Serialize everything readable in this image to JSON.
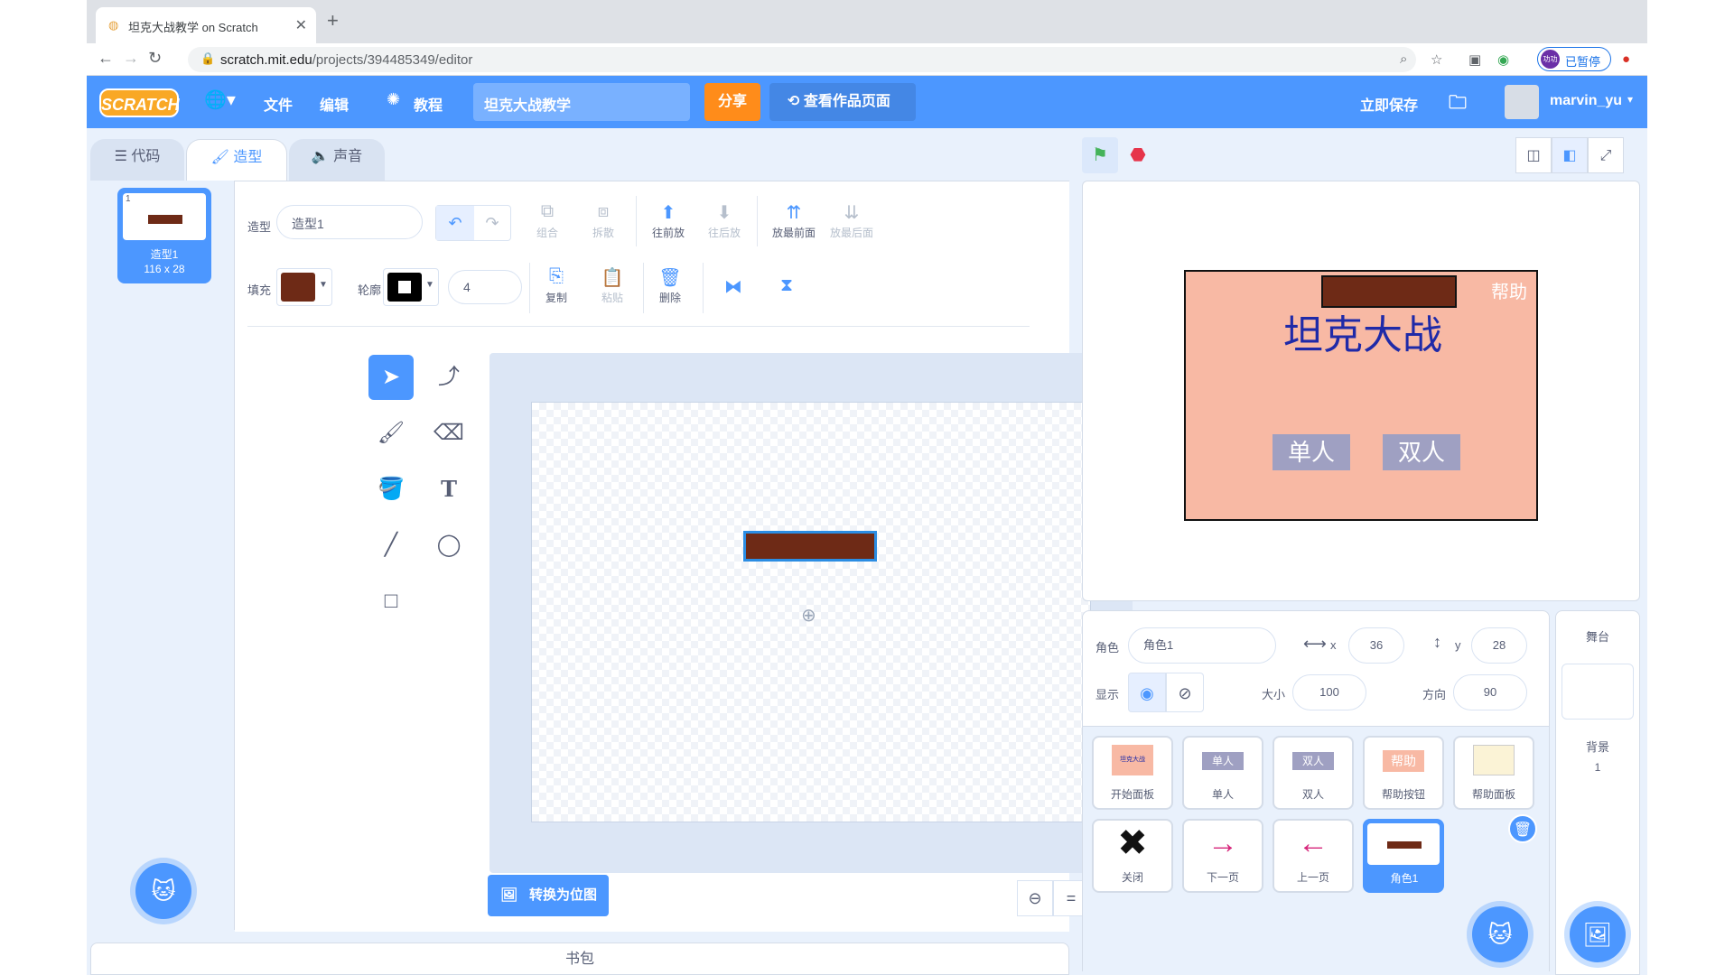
{
  "browser": {
    "tab_title": "坦克大战教学 on Scratch",
    "url_host": "scratch.mit.edu",
    "url_path": "/projects/394485349/editor",
    "profile_status": "已暂停",
    "profile_avatar_text": "功功"
  },
  "menu": {
    "logo": "SCRATCH",
    "file": "文件",
    "edit": "编辑",
    "tutorials": "教程",
    "project_title": "坦克大战教学",
    "share": "分享",
    "see_project_page": "查看作品页面",
    "save_now": "立即保存",
    "username": "marvin_yu"
  },
  "tabs": {
    "code": "代码",
    "costumes": "造型",
    "sounds": "声音"
  },
  "costume_list": [
    {
      "number": "1",
      "name": "造型1",
      "size": "116 x 28"
    }
  ],
  "paint": {
    "costume_label": "造型",
    "costume_name": "造型1",
    "fill_label": "填充",
    "outline_label": "轮廓",
    "outline_width": "4",
    "group": "组合",
    "ungroup": "拆散",
    "forward": "往前放",
    "backward": "往后放",
    "front": "放最前面",
    "back": "放最后面",
    "copy": "复制",
    "paste": "粘贴",
    "delete": "删除",
    "convert_bitmap": "转换为位图",
    "fill_color": "#6e2a16",
    "outline_color": "#000000"
  },
  "backpack": "书包",
  "stage": {
    "title": "坦克大战",
    "help": "帮助",
    "single": "单人",
    "double": "双人"
  },
  "sprite_info": {
    "sprite_label": "角色",
    "sprite_name": "角色1",
    "x_label": "x",
    "x_value": "36",
    "y_label": "y",
    "y_value": "28",
    "show_label": "显示",
    "size_label": "大小",
    "size_value": "100",
    "direction_label": "方向",
    "direction_value": "90"
  },
  "sprites": [
    {
      "name": "开始面板",
      "thumb_text": "坦克大战"
    },
    {
      "name": "单人",
      "thumb_text": "单人"
    },
    {
      "name": "双人",
      "thumb_text": "双人"
    },
    {
      "name": "帮助按钮",
      "thumb_text": "帮助"
    },
    {
      "name": "帮助面板",
      "thumb_text": ""
    },
    {
      "name": "关闭",
      "thumb_text": ""
    },
    {
      "name": "下一页",
      "thumb_text": ""
    },
    {
      "name": "上一页",
      "thumb_text": ""
    },
    {
      "name": "角色1",
      "thumb_text": ""
    }
  ],
  "stage_target": {
    "header": "舞台",
    "backdrops_label": "背景",
    "backdrop_count": "1"
  }
}
